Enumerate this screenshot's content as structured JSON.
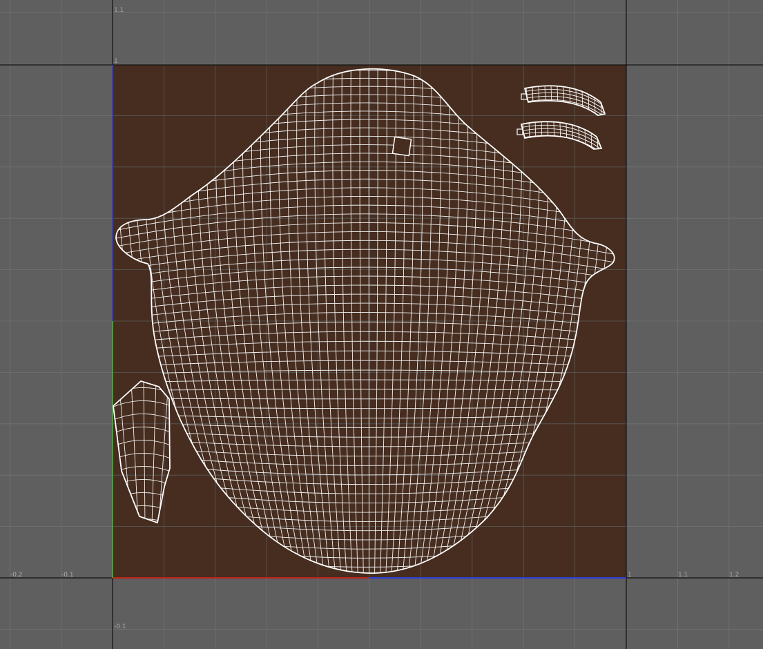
{
  "viewport": {
    "background_color": "#5f5f5f",
    "grid_color": "#727272",
    "axis_line_color": "#111111",
    "uv_tile_color": "#462d1f",
    "wireframe_color": "#ffffff",
    "u_axis_color": "#c0241c",
    "v_axis_color": "#2eae2e",
    "boundary_blue_color": "#2b3fd6"
  },
  "axis_labels": {
    "v_1_1": "1.1",
    "v_1": "1",
    "v_neg_0_1": "-0.1",
    "u_neg_0_2": "-0.2",
    "u_neg_0_1": "-0.1",
    "u_1": "1",
    "u_1_1": "1.1",
    "u_1_2": "1.2"
  },
  "uv_range": {
    "u": [
      0,
      1
    ],
    "v": [
      0,
      1
    ]
  },
  "shells": [
    "head-shell",
    "eyebrow-strip-top",
    "eyebrow-strip-bottom",
    "small-side-shell"
  ]
}
